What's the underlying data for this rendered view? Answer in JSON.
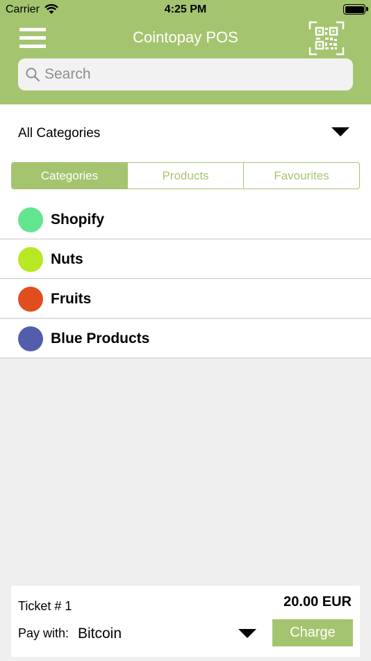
{
  "status_bar": {
    "carrier": "Carrier",
    "time": "4:25 PM"
  },
  "header": {
    "title": "Cointopay POS"
  },
  "search": {
    "placeholder": "Search",
    "value": ""
  },
  "category_filter": {
    "selected": "All Categories"
  },
  "tabs": [
    {
      "label": "Categories",
      "active": true
    },
    {
      "label": "Products",
      "active": false
    },
    {
      "label": "Favourites",
      "active": false
    }
  ],
  "categories": [
    {
      "label": "Shopify",
      "color": "#63e590"
    },
    {
      "label": "Nuts",
      "color": "#b8e823"
    },
    {
      "label": "Fruits",
      "color": "#e04e1e"
    },
    {
      "label": "Blue Products",
      "color": "#525dac"
    }
  ],
  "footer": {
    "ticket": "Ticket # 1",
    "total": "20.00 EUR",
    "pay_label": "Pay with:",
    "pay_method": "Bitcoin",
    "charge_label": "Charge"
  },
  "colors": {
    "accent": "#a5c470"
  },
  "icons": {
    "menu": "hamburger-menu-icon",
    "qr": "qr-code-icon",
    "search": "search-icon",
    "wifi": "wifi-icon",
    "battery": "battery-icon"
  }
}
